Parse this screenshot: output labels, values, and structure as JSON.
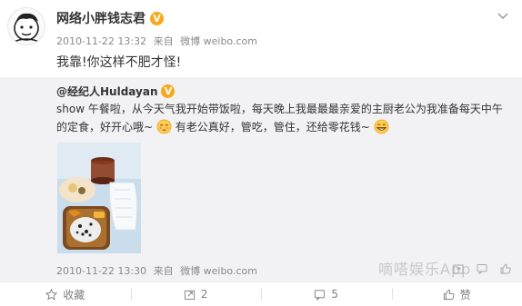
{
  "post": {
    "author": "网络小胖钱志君",
    "verified_badge": "V",
    "time": "2010-11-22 13:32",
    "source_prefix": "来自",
    "source": "微博 weibo.com",
    "text": "我靠!你这样不肥才怪!"
  },
  "repost": {
    "author": "@经纪人Huldayan",
    "verified_badge": "V",
    "text_part1": "show 午餐啦，从今天气我开始带饭啦，每天晚上我最最最亲爱的主厨老公为我准备每天中午的定食，好开心哦~",
    "text_part2": "有老公真好，管吃，管住，还给零花钱~",
    "time": "2010-11-22 13:30",
    "source_prefix": "来自",
    "source": "微博 weibo.com",
    "watermark": "嘀嗒娱乐App"
  },
  "actions": {
    "favorite_label": "收藏",
    "repost_count": "2",
    "comment_count": "5",
    "like_label": "赞"
  },
  "icons": [
    "avatar-sketch-icon",
    "chevron-down-icon",
    "verified-badge-icon",
    "blush-emoji-icon",
    "grin-emoji-icon",
    "star-icon",
    "repost-icon",
    "comment-icon",
    "thumbs-up-icon"
  ],
  "colors": {
    "verified": "#f7a81b",
    "repost_bg": "#f2f2f5",
    "meta_text": "#8a8a8a"
  }
}
